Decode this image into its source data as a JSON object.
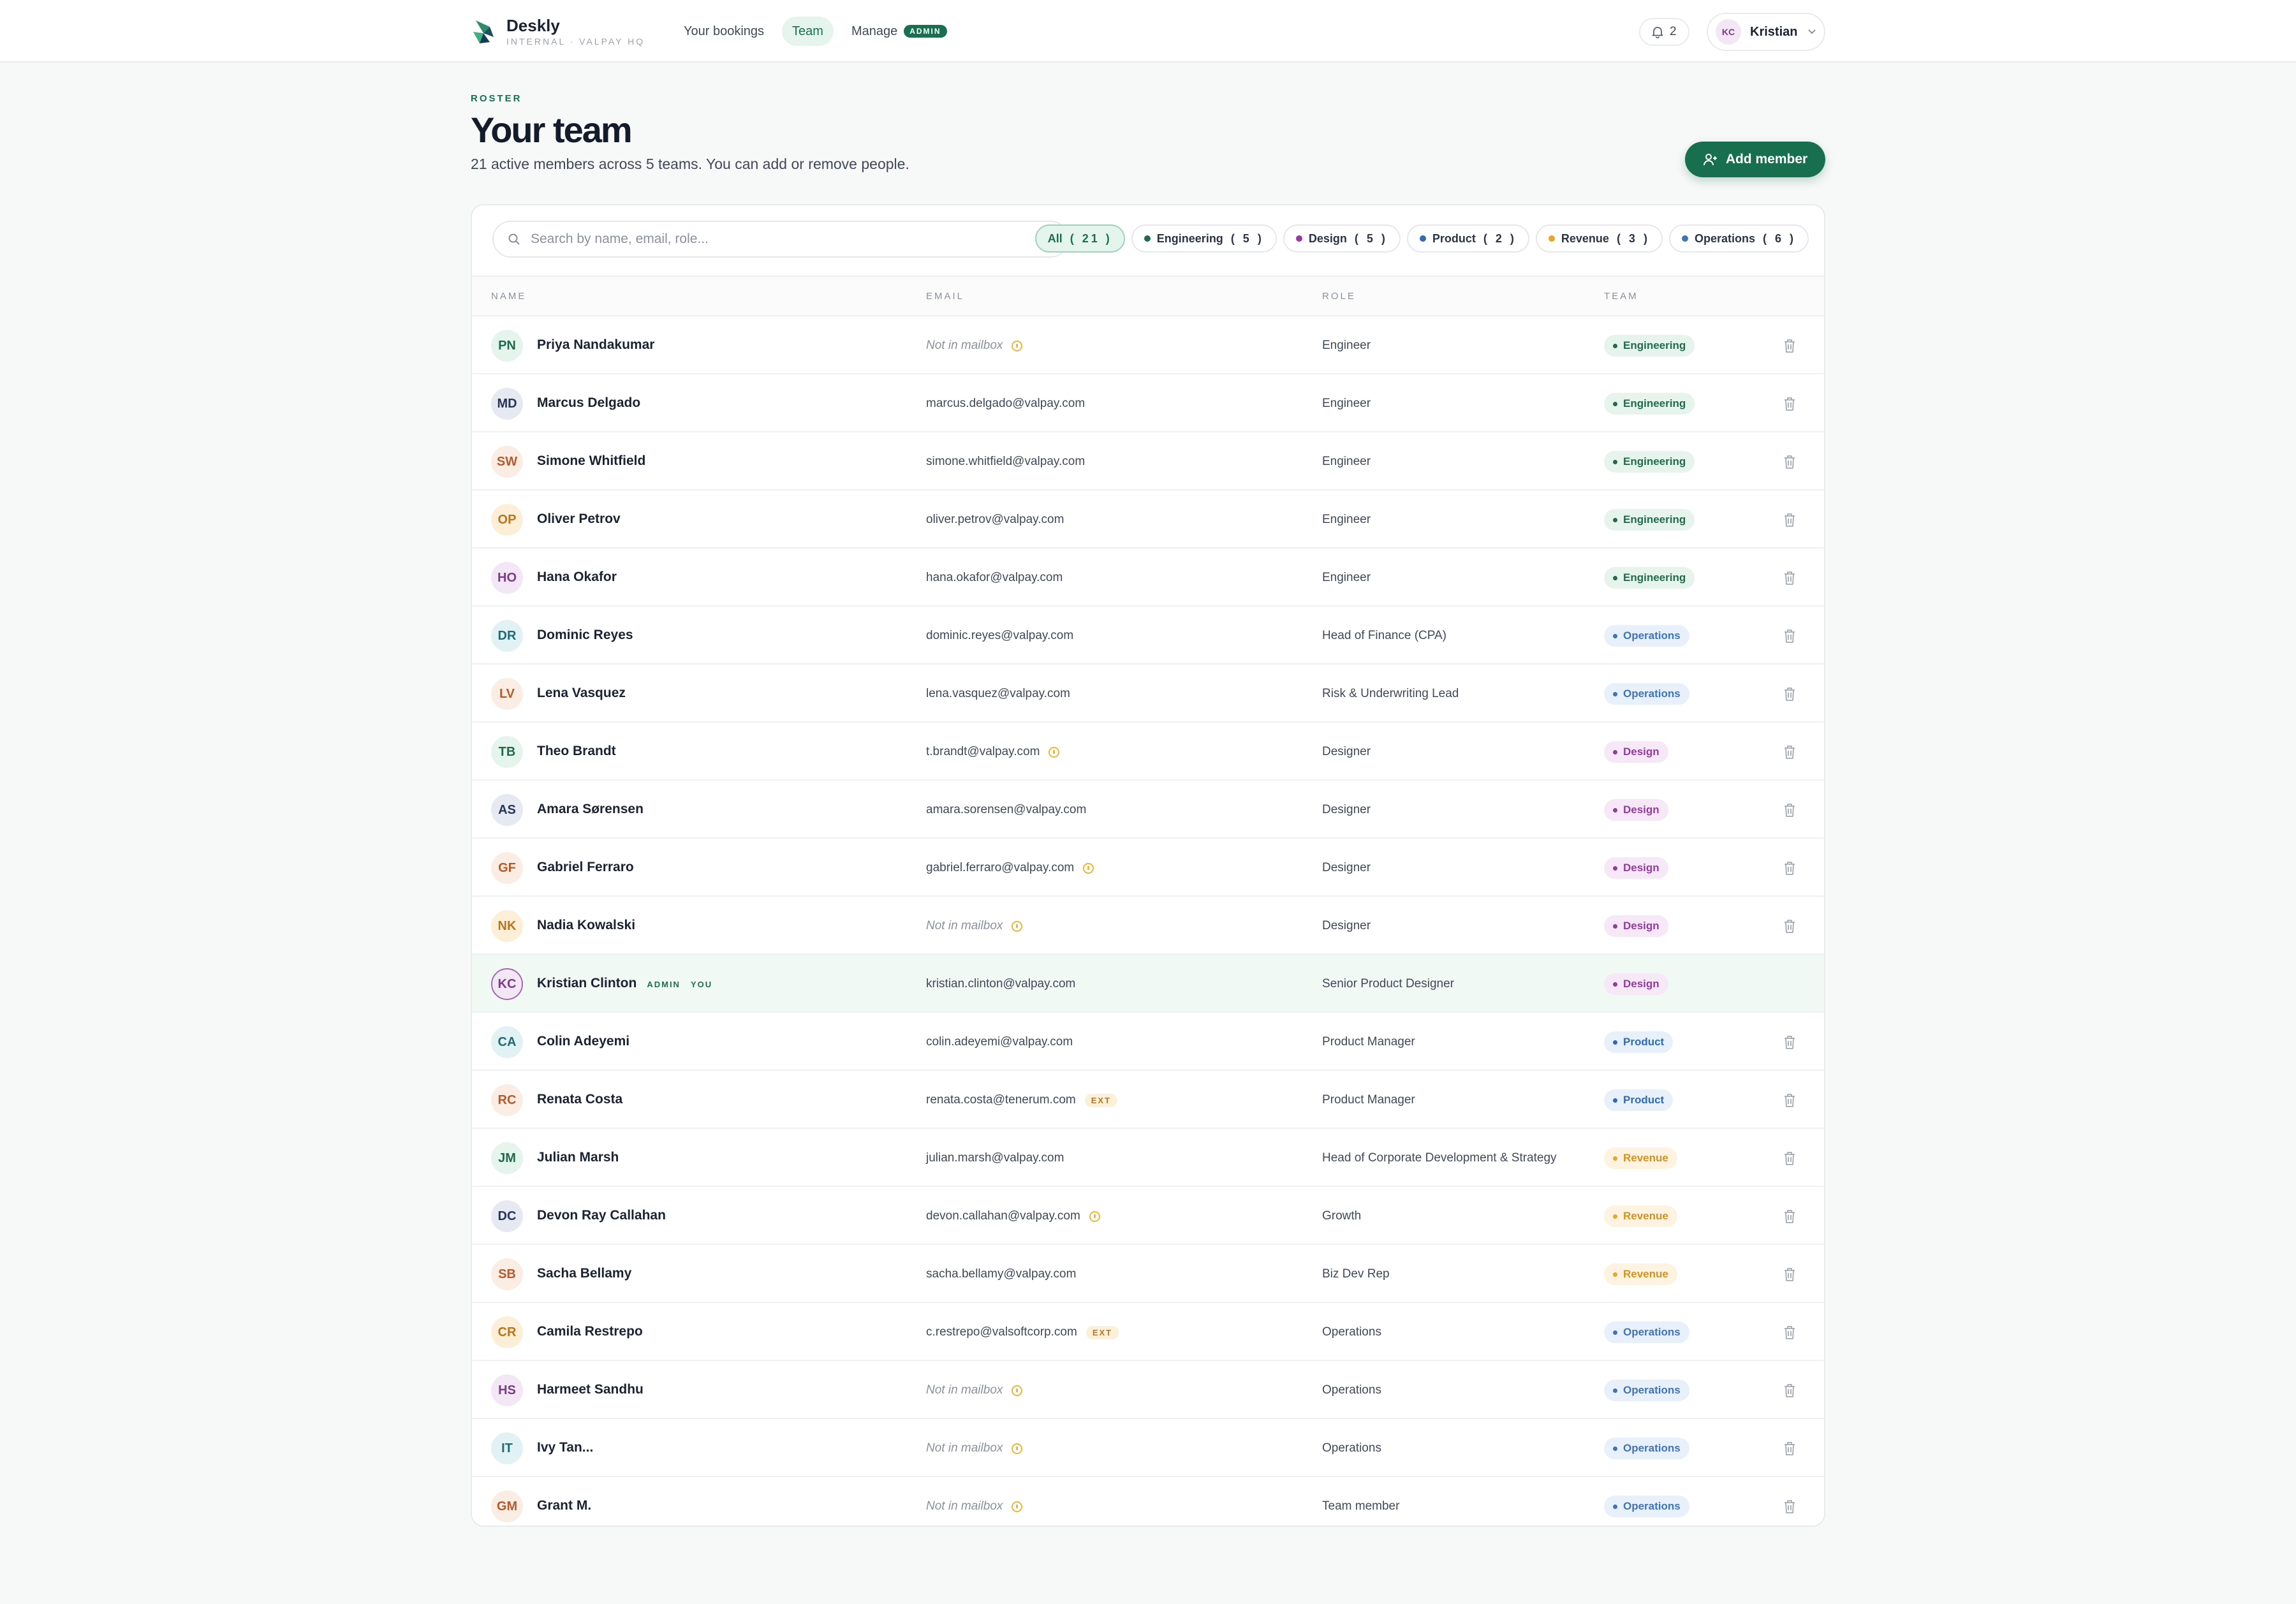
{
  "brand": {
    "name": "Deskly",
    "subtitle": "INTERNAL · VALPAY HQ"
  },
  "nav": {
    "items": [
      {
        "label": "Your bookings",
        "active": false
      },
      {
        "label": "Team",
        "active": true
      },
      {
        "label": "Manage",
        "active": false,
        "badge": "ADMIN"
      }
    ]
  },
  "header": {
    "notifications_count": "2",
    "user": {
      "initials": "KC",
      "name": "Kristian"
    }
  },
  "page": {
    "eyebrow": "ROSTER",
    "title": "Your team",
    "subtitle": "21 active members across 5 teams. You can add or remove people.",
    "add_button": "Add member"
  },
  "search": {
    "placeholder": "Search by name, email, role...",
    "value": ""
  },
  "filters": [
    {
      "label": "All",
      "count": "( 21 )",
      "active": true,
      "color": ""
    },
    {
      "label": "Engineering",
      "count": "( 5 )",
      "active": false,
      "color": "#1f6b4c"
    },
    {
      "label": "Design",
      "count": "( 5 )",
      "active": false,
      "color": "#963aa0"
    },
    {
      "label": "Product",
      "count": "( 2 )",
      "active": false,
      "color": "#2e6bb5"
    },
    {
      "label": "Revenue",
      "count": "( 3 )",
      "active": false,
      "color": "#e9a52b"
    },
    {
      "label": "Operations",
      "count": "( 6 )",
      "active": false,
      "color": "#3e75b8"
    }
  ],
  "table": {
    "columns": [
      "NAME",
      "EMAIL",
      "ROLE",
      "TEAM"
    ],
    "rows": [
      {
        "initials": "PN",
        "name": "Priya Nandakumar",
        "email": "Not in mailbox",
        "email_missing": true,
        "warn": true,
        "ext": "",
        "role": "Engineer",
        "team": "Engineering",
        "avatar_bg": "#e6f4ee",
        "avatar_fg": "#1f6b4c"
      },
      {
        "initials": "MD",
        "name": "Marcus Delgado",
        "email": "marcus.delgado@valpay.com",
        "email_missing": false,
        "warn": false,
        "ext": "",
        "role": "Engineer",
        "team": "Engineering",
        "avatar_bg": "#e6e9f2",
        "avatar_fg": "#263556"
      },
      {
        "initials": "SW",
        "name": "Simone Whitfield",
        "email": "simone.whitfield@valpay.com",
        "email_missing": false,
        "warn": false,
        "ext": "",
        "role": "Engineer",
        "team": "Engineering",
        "avatar_bg": "#fbede4",
        "avatar_fg": "#b55a2c"
      },
      {
        "initials": "OP",
        "name": "Oliver Petrov",
        "email": "oliver.petrov@valpay.com",
        "email_missing": false,
        "warn": false,
        "ext": "",
        "role": "Engineer",
        "team": "Engineering",
        "avatar_bg": "#fdefd7",
        "avatar_fg": "#b8751c"
      },
      {
        "initials": "HO",
        "name": "Hana Okafor",
        "email": "hana.okafor@valpay.com",
        "email_missing": false,
        "warn": false,
        "ext": "",
        "role": "Engineer",
        "team": "Engineering",
        "avatar_bg": "#f3e6f5",
        "avatar_fg": "#7c3a87"
      },
      {
        "initials": "DR",
        "name": "Dominic Reyes",
        "email": "dominic.reyes@valpay.com",
        "email_missing": false,
        "warn": false,
        "ext": "",
        "role": "Head of Finance (CPA)",
        "team": "Operations",
        "avatar_bg": "#e2f2f4",
        "avatar_fg": "#1d6b74"
      },
      {
        "initials": "LV",
        "name": "Lena Vasquez",
        "email": "lena.vasquez@valpay.com",
        "email_missing": false,
        "warn": false,
        "ext": "",
        "role": "Risk & Underwriting Lead",
        "team": "Operations",
        "avatar_bg": "#fbede4",
        "avatar_fg": "#b55a2c"
      },
      {
        "initials": "TB",
        "name": "Theo Brandt",
        "email": "t.brandt@valpay.com",
        "email_missing": false,
        "warn": true,
        "ext": "",
        "role": "Designer",
        "team": "Design",
        "avatar_bg": "#e6f4ee",
        "avatar_fg": "#1f6b4c"
      },
      {
        "initials": "AS",
        "name": "Amara Sørensen",
        "email": "amara.sorensen@valpay.com",
        "email_missing": false,
        "warn": false,
        "ext": "",
        "role": "Designer",
        "team": "Design",
        "avatar_bg": "#e6e9f2",
        "avatar_fg": "#263556"
      },
      {
        "initials": "GF",
        "name": "Gabriel Ferraro",
        "email": "gabriel.ferraro@valpay.com",
        "email_missing": false,
        "warn": true,
        "ext": "",
        "role": "Designer",
        "team": "Design",
        "avatar_bg": "#fbede4",
        "avatar_fg": "#b55a2c"
      },
      {
        "initials": "NK",
        "name": "Nadia Kowalski",
        "email": "Not in mailbox",
        "email_missing": true,
        "warn": true,
        "ext": "",
        "role": "Designer",
        "team": "Design",
        "avatar_bg": "#fdefd7",
        "avatar_fg": "#b8751c"
      },
      {
        "initials": "KC",
        "name": "Kristian Clinton",
        "email": "kristian.clinton@valpay.com",
        "email_missing": false,
        "warn": false,
        "ext": "",
        "role": "Senior Product Designer",
        "team": "Design",
        "avatar_bg": "#f3e6f5",
        "avatar_fg": "#7c3a87",
        "is_me": true,
        "tag_admin": "ADMIN",
        "tag_you": "YOU"
      },
      {
        "initials": "CA",
        "name": "Colin Adeyemi",
        "email": "colin.adeyemi@valpay.com",
        "email_missing": false,
        "warn": false,
        "ext": "",
        "role": "Product Manager",
        "team": "Product",
        "avatar_bg": "#e2f2f4",
        "avatar_fg": "#1d6b74"
      },
      {
        "initials": "RC",
        "name": "Renata Costa",
        "email": "renata.costa@tenerum.com",
        "email_missing": false,
        "warn": false,
        "ext": "EXT",
        "role": "Product Manager",
        "team": "Product",
        "avatar_bg": "#fbede4",
        "avatar_fg": "#b55a2c"
      },
      {
        "initials": "JM",
        "name": "Julian Marsh",
        "email": "julian.marsh@valpay.com",
        "email_missing": false,
        "warn": false,
        "ext": "",
        "role": "Head of Corporate Development & Strategy",
        "team": "Revenue",
        "avatar_bg": "#e6f4ee",
        "avatar_fg": "#1f6b4c"
      },
      {
        "initials": "DC",
        "name": "Devon Ray Callahan",
        "email": "devon.callahan@valpay.com",
        "email_missing": false,
        "warn": true,
        "ext": "",
        "role": "Growth",
        "team": "Revenue",
        "avatar_bg": "#e6e9f2",
        "avatar_fg": "#263556"
      },
      {
        "initials": "SB",
        "name": "Sacha Bellamy",
        "email": "sacha.bellamy@valpay.com",
        "email_missing": false,
        "warn": false,
        "ext": "",
        "role": "Biz Dev Rep",
        "team": "Revenue",
        "avatar_bg": "#fbede4",
        "avatar_fg": "#b55a2c"
      },
      {
        "initials": "CR",
        "name": "Camila Restrepo",
        "email": "c.restrepo@valsoftcorp.com",
        "email_missing": false,
        "warn": false,
        "ext": "EXT",
        "role": "Operations",
        "team": "Operations",
        "avatar_bg": "#fdefd7",
        "avatar_fg": "#b8751c"
      },
      {
        "initials": "HS",
        "name": "Harmeet Sandhu",
        "email": "Not in mailbox",
        "email_missing": true,
        "warn": true,
        "ext": "",
        "role": "Operations",
        "team": "Operations",
        "avatar_bg": "#f3e6f5",
        "avatar_fg": "#7c3a87"
      },
      {
        "initials": "IT",
        "name": "Ivy Tan...",
        "email": "Not in mailbox",
        "email_missing": true,
        "warn": true,
        "ext": "",
        "role": "Operations",
        "team": "Operations",
        "avatar_bg": "#e2f2f4",
        "avatar_fg": "#1d6b74"
      },
      {
        "initials": "GM",
        "name": "Grant M.",
        "email": "Not in mailbox",
        "email_missing": true,
        "warn": true,
        "ext": "",
        "role": "Team member",
        "team": "Operations",
        "avatar_bg": "#fbede4",
        "avatar_fg": "#b55a2c"
      }
    ]
  }
}
